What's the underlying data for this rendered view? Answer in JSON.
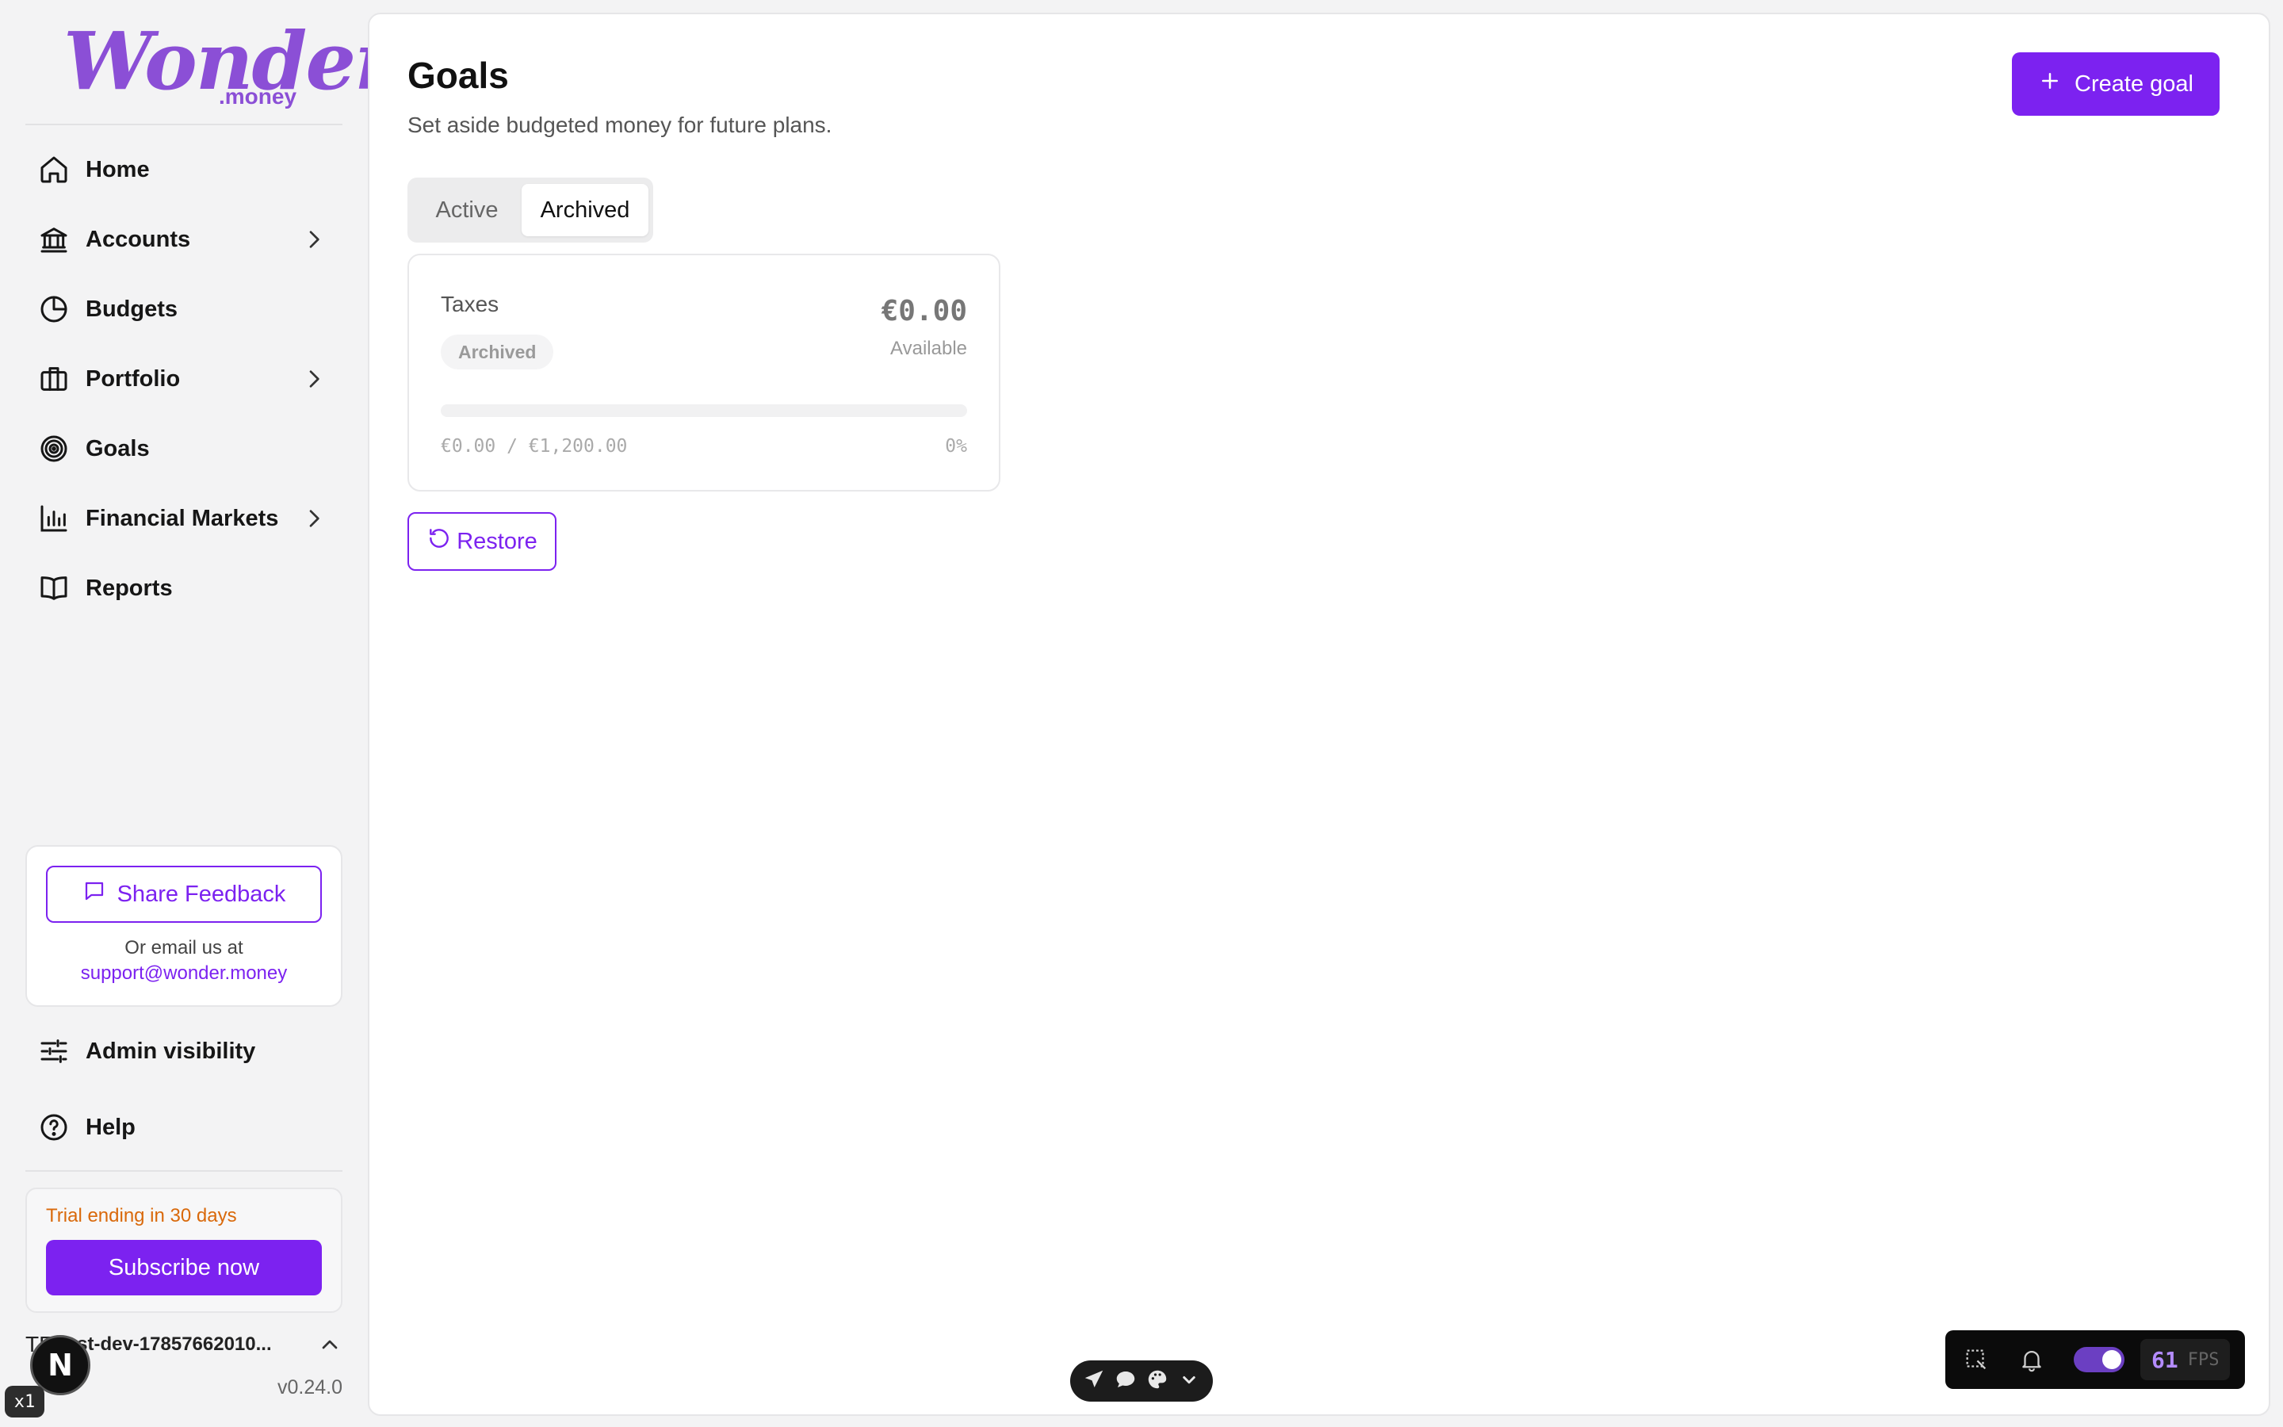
{
  "brand": {
    "logo_word": "Wonder",
    "logo_sub": ".money",
    "accent": "#7c22f0",
    "logo_color": "#8b4fd6"
  },
  "sidebar": {
    "items": [
      {
        "label": "Home",
        "icon": "home-icon",
        "chevron": false
      },
      {
        "label": "Accounts",
        "icon": "bank-icon",
        "chevron": true
      },
      {
        "label": "Budgets",
        "icon": "pie-chart-icon",
        "chevron": false
      },
      {
        "label": "Portfolio",
        "icon": "briefcase-icon",
        "chevron": true
      },
      {
        "label": "Goals",
        "icon": "target-icon",
        "chevron": false
      },
      {
        "label": "Financial Markets",
        "icon": "bar-chart-icon",
        "chevron": true
      },
      {
        "label": "Reports",
        "icon": "book-icon",
        "chevron": false
      }
    ],
    "feedback": {
      "button_label": "Share Feedback",
      "email_prompt": "Or email us at",
      "email": "support@wonder.money"
    },
    "admin_visibility": "Admin visibility",
    "help": "Help",
    "trial": {
      "text": "Trial ending in 30 days",
      "subscribe_label": "Subscribe now",
      "text_color": "#d9690b"
    },
    "workspace": {
      "initials": "TE",
      "name": "test-dev-17857662010..."
    },
    "version": "v0.24.0"
  },
  "main": {
    "title": "Goals",
    "subtitle": "Set aside budgeted money for future plans.",
    "create_button_label": "Create goal",
    "tabs": [
      {
        "label": "Active",
        "active": false
      },
      {
        "label": "Archived",
        "active": true
      }
    ],
    "goal": {
      "name": "Taxes",
      "status": "Archived",
      "amount": "€0.00",
      "amount_label": "Available",
      "progress_text": "€0.00 / €1,200.00",
      "progress_pct": "0%",
      "progress_fraction": 0
    },
    "restore_label": "Restore"
  },
  "overlays": {
    "next_badge": "N",
    "speed_badge": "x1",
    "fps_value": "61",
    "fps_label": "FPS"
  }
}
